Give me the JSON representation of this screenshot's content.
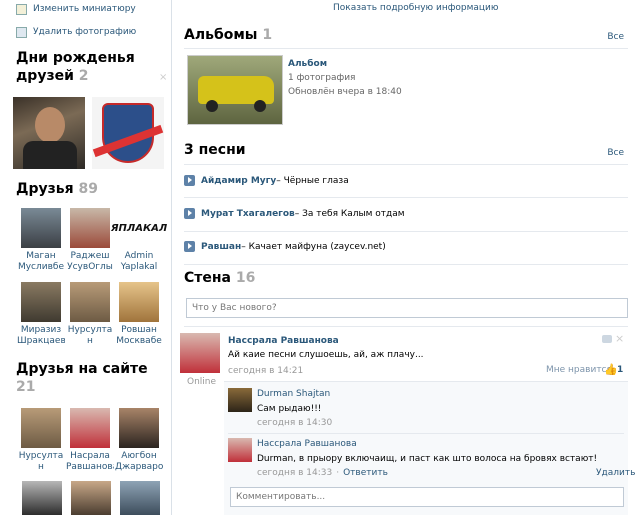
{
  "left": {
    "actions": {
      "change_thumb": "Изменить миниатюру",
      "delete_photo": "Удалить фотографию"
    },
    "birthdays": {
      "title_line1": "Дни рожденья",
      "title_line2": "друзей",
      "count": "2",
      "close": "×"
    },
    "friends": {
      "title": "Друзья",
      "count": "89",
      "items": [
        {
          "name": "Маган Мусливбе"
        },
        {
          "name": "Раджеш УсувОглы"
        },
        {
          "name": "Admin Yaplakal"
        },
        {
          "name": "Миразиз Шракцаев"
        },
        {
          "name": "Нурсулта н"
        },
        {
          "name": "Ровшан Москвабе"
        }
      ]
    },
    "online": {
      "title": "Друзья на сайте",
      "count": "21",
      "items": [
        {
          "name": "Нурсулта н"
        },
        {
          "name": "Насрала Равшанова"
        },
        {
          "name": "Аюгбон Джарваро"
        }
      ]
    },
    "logo_text": "ЯПЛАКАЛ"
  },
  "right": {
    "top_link": "Показать подробную информацию",
    "albums": {
      "title": "Альбомы",
      "count": "1",
      "all": "Все",
      "album": {
        "name": "Альбом",
        "photos": "1 фотография",
        "updated": "Обновлён вчера в 18:40"
      }
    },
    "songs": {
      "title": "3 песни",
      "all": "Все",
      "items": [
        {
          "artist": "Айдамир Мугу",
          "title": " – Чёрные глаза"
        },
        {
          "artist": "Мурат Тхагалегов",
          "title": " – За тебя Калым отдам"
        },
        {
          "artist": "Равшан",
          "title": " – Качает майфуна (zaycev.net)"
        }
      ]
    },
    "wall": {
      "title": "Стена",
      "count": "16",
      "placeholder": "Что у Вас нового?",
      "post": {
        "author": "Нассрала Равшанова",
        "text": "Ай каие песни слушоешь, ай, аж плачу...",
        "time": "сегодня в 14:21",
        "likes_label": "Мне нравится",
        "likes_count": "1",
        "status": "Online"
      },
      "comments": [
        {
          "author": "Durman Shajtan",
          "text": "Сам рыдаю!!!",
          "time": "сегодня в 14:30"
        },
        {
          "author": "Нассрала Равшанова",
          "text": "Durman, в прыору включаищ, и паст как што волоса на бровях встают!",
          "time": "сегодня в 14:33",
          "reply": "Ответить",
          "delete": "Удалить"
        }
      ],
      "comment_placeholder": "Комментировать..."
    }
  }
}
